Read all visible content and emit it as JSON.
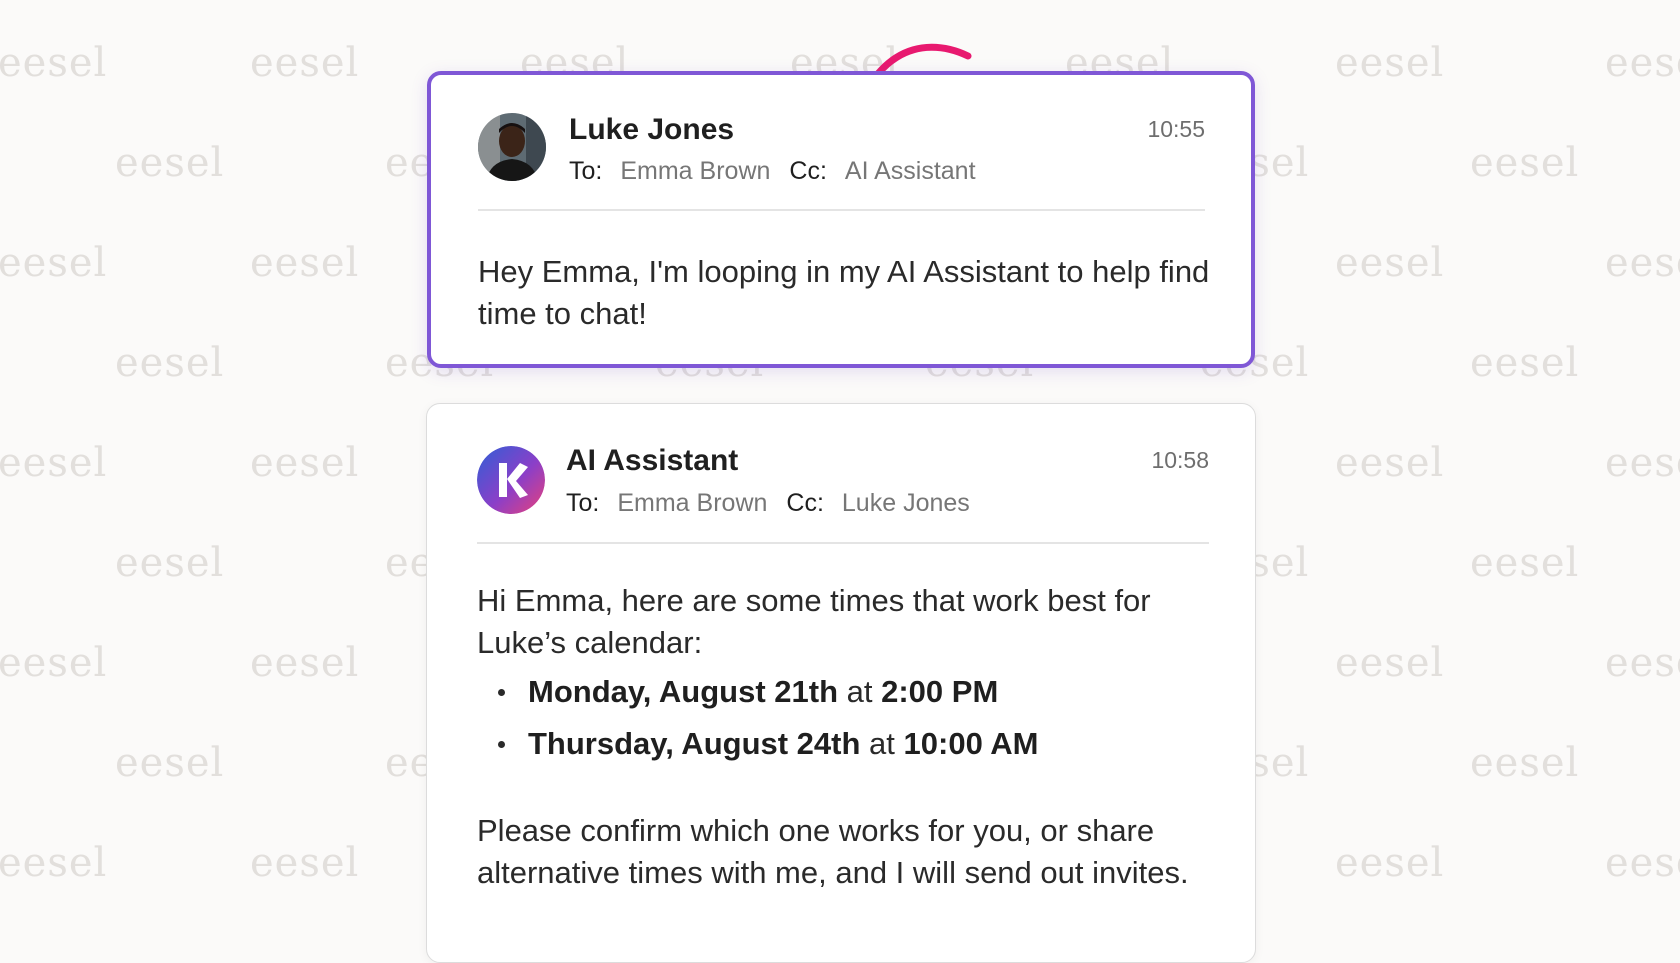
{
  "watermark": {
    "text": "eesel"
  },
  "messages": [
    {
      "sender": "Luke Jones",
      "time": "10:55",
      "to_label": "To:",
      "to": "Emma Brown",
      "cc_label": "Cc:",
      "cc": "AI Assistant",
      "avatar": "person-photo",
      "body": "Hey Emma, I'm looping in my AI Assistant to help find time to chat!"
    },
    {
      "sender": "AI Assistant",
      "time": "10:58",
      "to_label": "To:",
      "to": "Emma Brown",
      "cc_label": "Cc:",
      "cc": "Luke Jones",
      "avatar": "k-logo",
      "intro": "Hi Emma, here are some times that work best for Luke’s calendar:",
      "slots": [
        {
          "day": "Monday, August 21th",
          "at": "at",
          "time": "2:00 PM"
        },
        {
          "day": "Thursday, August 24th",
          "at": "at",
          "time": "10:00 AM"
        }
      ],
      "closing": "Please confirm which one works for you, or share alternative times with me, and I will send out invites."
    }
  ],
  "colors": {
    "highlight_border": "#7f57d6",
    "arrow": "#e8196f",
    "logo_gradient": [
      "#2f5fd6",
      "#8b3fc8",
      "#e8417a"
    ]
  }
}
